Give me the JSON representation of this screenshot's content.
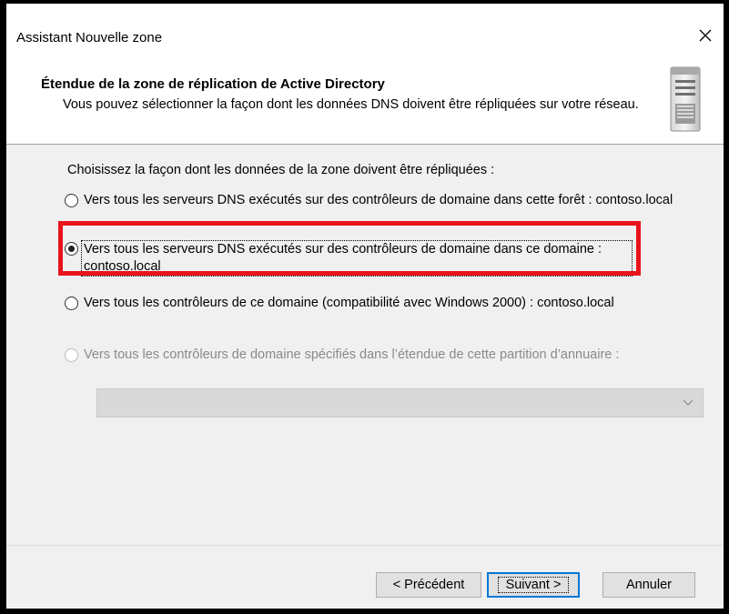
{
  "window": {
    "title": "Assistant Nouvelle zone",
    "close_glyph": "×"
  },
  "header": {
    "title": "Étendue de la zone de réplication de Active Directory",
    "description": "Vous pouvez sélectionner la façon dont les données DNS doivent être répliquées sur votre réseau.",
    "icon": "server-icon"
  },
  "body": {
    "prompt": "Choisissez la façon dont les données de la zone doivent être répliquées :",
    "options": [
      {
        "label": "Vers tous les serveurs DNS exécutés sur des contrôleurs de domaine dans cette forêt : contoso.local",
        "checked": false,
        "enabled": true
      },
      {
        "label": "Vers tous les serveurs DNS exécutés sur des contrôleurs de domaine dans ce domaine : contoso.local",
        "checked": true,
        "enabled": true
      },
      {
        "label": "Vers tous les contrôleurs de ce domaine (compatibilité avec Windows 2000) : contoso.local",
        "checked": false,
        "enabled": true
      },
      {
        "label": "Vers tous les contrôleurs de domaine spécifiés dans l’étendue de cette partition d’annuaire :",
        "checked": false,
        "enabled": false
      }
    ],
    "partition_dropdown": {
      "value": "",
      "enabled": false
    },
    "highlight_color": "#e8141b"
  },
  "footer": {
    "prev_label": "< Précédent",
    "next_label": "Suivant >",
    "cancel_label": "Annuler"
  }
}
